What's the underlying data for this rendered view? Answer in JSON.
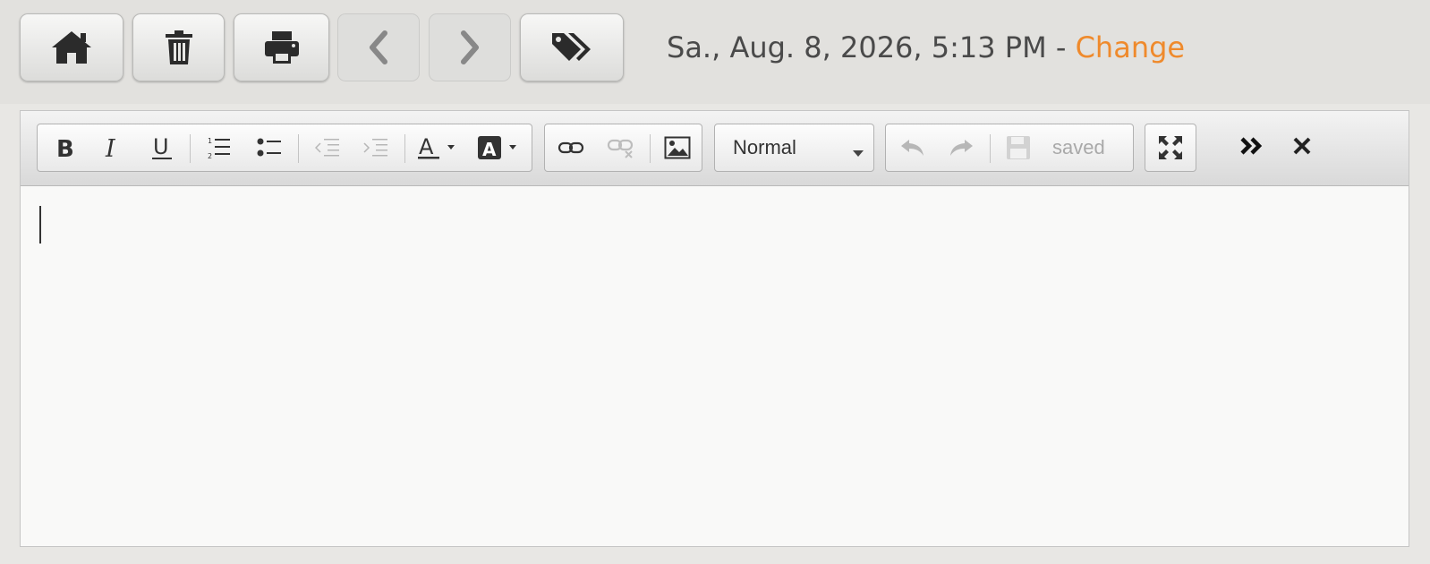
{
  "header": {
    "date_text": "Sa., Aug. 8, 2026, 5:13 PM - ",
    "change_label": "Change",
    "change_color": "#ef8a2c",
    "buttons": [
      {
        "name": "home",
        "icon": "home-icon",
        "enabled": true
      },
      {
        "name": "delete",
        "icon": "trash-icon",
        "enabled": true
      },
      {
        "name": "print",
        "icon": "printer-icon",
        "enabled": true
      },
      {
        "name": "previous",
        "icon": "chevron-left-icon",
        "enabled": false
      },
      {
        "name": "next",
        "icon": "chevron-right-icon",
        "enabled": false
      },
      {
        "name": "tags",
        "icon": "tags-icon",
        "enabled": true
      }
    ]
  },
  "toolbar": {
    "format_value": "Normal",
    "save_status": "saved",
    "groups": {
      "text": [
        "bold-icon",
        "italic-icon",
        "underline-icon",
        "numbered-list-icon",
        "bulleted-list-icon",
        "outdent-icon",
        "indent-icon",
        "text-color-icon",
        "background-color-icon"
      ],
      "insert": [
        "link-icon",
        "unlink-icon",
        "image-icon"
      ],
      "history": [
        "undo-icon",
        "redo-icon",
        "save-icon"
      ],
      "view": [
        "maximize-icon",
        "more-icon",
        "close-icon"
      ]
    },
    "disabled": [
      "outdent-icon",
      "indent-icon",
      "unlink-icon",
      "undo-icon",
      "redo-icon",
      "save-icon"
    ]
  },
  "editor": {
    "content": ""
  }
}
